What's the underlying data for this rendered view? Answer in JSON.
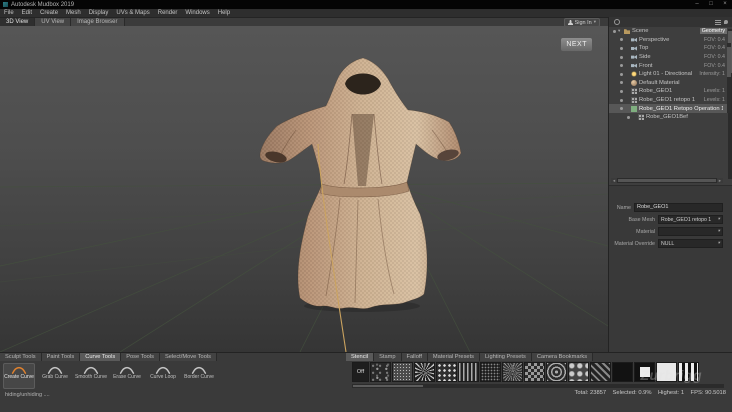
{
  "window": {
    "title": "Autodesk Mudbox 2019",
    "controls": [
      {
        "name": "minimize-button",
        "glyph": "–"
      },
      {
        "name": "maximize-button",
        "glyph": "□"
      },
      {
        "name": "close-button",
        "glyph": "×"
      }
    ]
  },
  "menubar": [
    {
      "label": "File"
    },
    {
      "label": "Edit"
    },
    {
      "label": "Create"
    },
    {
      "label": "Mesh"
    },
    {
      "label": "Display"
    },
    {
      "label": "UVs & Maps"
    },
    {
      "label": "Render"
    },
    {
      "label": "Windows"
    },
    {
      "label": "Help"
    }
  ],
  "view_tabs": [
    {
      "label": "3D View",
      "active": true
    },
    {
      "label": "UV View"
    },
    {
      "label": "Image Browser"
    }
  ],
  "account": {
    "signin_label": "Sign In"
  },
  "viewport": {
    "overlay_button": "NEXT"
  },
  "object_list": {
    "rows": [
      {
        "label": "Scene",
        "value": "Geometry",
        "icon": "folder-icon",
        "indent": 0,
        "expander": "▾",
        "value_selected": true
      },
      {
        "label": "Perspective",
        "value": "FOV: 0.4",
        "icon": "camera-icon",
        "indent": 1
      },
      {
        "label": "Top",
        "value": "FOV: 0.4",
        "icon": "camera-icon",
        "indent": 1
      },
      {
        "label": "Side",
        "value": "FOV: 0.4",
        "icon": "camera-icon",
        "indent": 1
      },
      {
        "label": "Front",
        "value": "FOV: 0.4",
        "icon": "camera-icon",
        "indent": 1
      },
      {
        "label": "Light 01 - Directional",
        "value": "Intensity: 1",
        "icon": "light-icon",
        "indent": 1
      },
      {
        "label": "Default Material",
        "value": "",
        "icon": "material-icon",
        "indent": 1
      },
      {
        "label": "Robe_GEO1",
        "value": "Levels: 1",
        "icon": "mesh-icon",
        "indent": 1
      },
      {
        "label": "Robe_GEO1 retopo 1",
        "value": "Levels: 1",
        "icon": "mesh-icon",
        "indent": 1
      },
      {
        "label": "Robe_GEO1 Retopo Operation 1",
        "value": "",
        "icon": "operation-icon",
        "indent": 1,
        "selected": true
      },
      {
        "label": "Robe_GEO1Bef",
        "value": "",
        "icon": "mesh-icon",
        "indent": 2
      }
    ]
  },
  "properties": {
    "name_label": "Name",
    "name_value": "Robe_GEO1",
    "rows": [
      {
        "label": "Base Mesh",
        "value": "Robe_GEO1 retopo 1"
      },
      {
        "label": "Material",
        "value": ""
      },
      {
        "label": "Material Override",
        "value": "NULL"
      }
    ]
  },
  "tool_tabs": [
    {
      "label": "Sculpt Tools"
    },
    {
      "label": "Paint Tools"
    },
    {
      "label": "Curve Tools",
      "active": true
    },
    {
      "label": "Pose Tools"
    },
    {
      "label": "Select/Move Tools"
    }
  ],
  "tools": [
    {
      "label": "Create Curve",
      "active": true
    },
    {
      "label": "Grab Curve"
    },
    {
      "label": "Smooth Curve"
    },
    {
      "label": "Erase Curve"
    },
    {
      "label": "Curve Loop"
    },
    {
      "label": "Border Curve"
    }
  ],
  "preset_tabs": [
    {
      "label": "Stencil",
      "active": true
    },
    {
      "label": "Stamp"
    },
    {
      "label": "Falloff"
    },
    {
      "label": "Material Presets"
    },
    {
      "label": "Lighting Presets"
    },
    {
      "label": "Camera Bookmarks"
    }
  ],
  "stencil_thumbs": [
    {
      "name": "stencil-off",
      "label": "Off",
      "pattern": "t-off"
    },
    {
      "name": "stencil-noise-dark",
      "pattern": "t-noise1"
    },
    {
      "name": "stencil-grain",
      "pattern": "t-noise2"
    },
    {
      "name": "stencil-starburst",
      "pattern": "t-burst"
    },
    {
      "name": "stencil-dots",
      "pattern": "t-dots"
    },
    {
      "name": "stencil-stripes",
      "pattern": "t-stripes"
    },
    {
      "name": "stencil-speckle",
      "pattern": "t-speckle"
    },
    {
      "name": "stencil-rays",
      "pattern": "t-rays"
    },
    {
      "name": "stencil-checker",
      "pattern": "t-checker"
    },
    {
      "name": "stencil-rings",
      "pattern": "t-rings"
    },
    {
      "name": "stencil-cells",
      "pattern": "t-cells"
    },
    {
      "name": "stencil-weave",
      "pattern": "t-weave"
    },
    {
      "name": "stencil-dark",
      "pattern": "t-dark"
    },
    {
      "name": "stencil-square",
      "pattern": "t-square"
    },
    {
      "name": "stencil-white",
      "pattern": "t-white"
    },
    {
      "name": "stencil-barcode",
      "pattern": "t-barcode"
    }
  ],
  "status": {
    "left": "hiding/unhiding ....",
    "right": "Total: 23857    Selected: 0.9%    Highest: 1    FPS: 90.5018"
  },
  "watermark": "Zurbrigg"
}
